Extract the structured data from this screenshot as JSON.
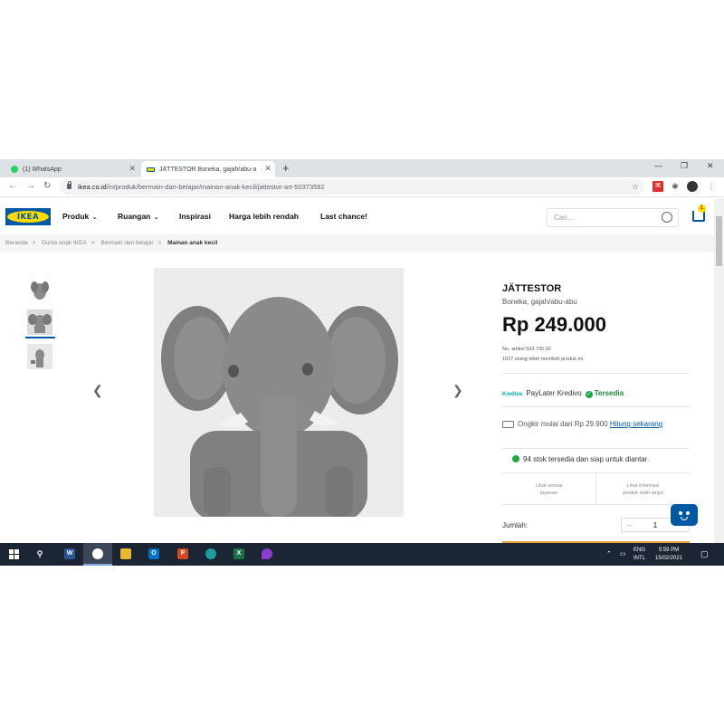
{
  "browser": {
    "tabs": [
      {
        "title": "(1) WhatsApp",
        "favicon": "whatsapp-icon"
      },
      {
        "title": "JÄTTESTOR Boneka, gajah/abu-a",
        "favicon": "ikea-icon"
      }
    ],
    "url_domain": "ikea.co.id",
    "url_path": "/in/produk/bermain-dan-belajar/mainan-anak-kecil/jattestor-art-50373592"
  },
  "header": {
    "logo": "IKEA",
    "menu": [
      "Produk",
      "Ruangan",
      "Inspirasi",
      "Harga lebih rendah",
      "Last chance!"
    ],
    "search_placeholder": "Cari...",
    "cart_count": "1"
  },
  "breadcrumb": [
    "Beranda",
    "Dunia anak IKEA",
    "Bermain dan belajar",
    "Mainan anak kecil"
  ],
  "product": {
    "name": "JÄTTESTOR",
    "description": "Boneka, gajah/abu-abu",
    "price": "Rp 249.000",
    "article_no": "No. artikel 503.735.92",
    "buyers": "1027 orang telah membeli produk ini",
    "kredivo_logo": "Kredivo",
    "paylater": "PayLater Kredivo",
    "paylater_status": "Tersedia",
    "shipping": "Ongkir mulai dari Rp 29.900",
    "shipping_link": "Hitung sekarang",
    "stock": "94 stok tersedia dan siap untuk diantar.",
    "link_left_1": "Lihat semua",
    "link_left_2": "layanan",
    "link_right_1": "Lihat informasi",
    "link_right_2": "produk lebih lanjut",
    "qty_label": "Jumlah:",
    "qty_value": "1"
  },
  "colors": {
    "ikea_blue": "#0058a3",
    "ikea_yellow": "#ffdb00",
    "available_green": "#22a745"
  },
  "taskbar": {
    "lang_1": "ENG",
    "lang_2": "INTL",
    "time": "5:59 PM",
    "date": "15/02/2021"
  }
}
